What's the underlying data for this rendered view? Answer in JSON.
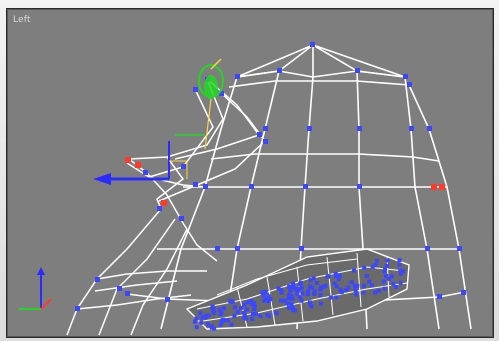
{
  "viewport": {
    "label": "Left",
    "background": "#7e7e7e",
    "wire_color": "#ffffff",
    "vertex_color": "#3b46ff",
    "selected_vertex_color": "#ff3a2a",
    "gizmo_color": "#2a2cff",
    "selected_object_color": "#22d822"
  },
  "axis_tripod": {
    "x_color": "#ff3a2a",
    "y_color": "#2a2cff",
    "z_color": "#22d822"
  }
}
